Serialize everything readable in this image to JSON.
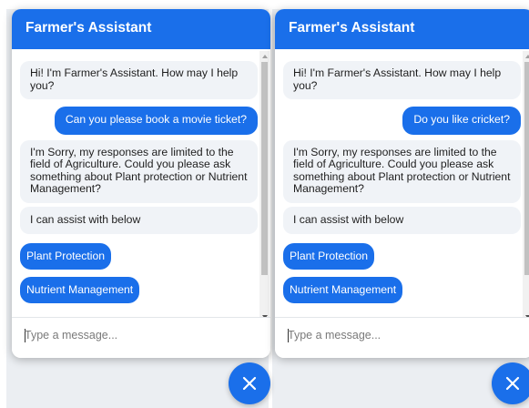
{
  "colors": {
    "accent": "#1a6fea",
    "bot_bubble": "#f0f3f7",
    "background": "#ebeef2"
  },
  "left_chat": {
    "title": "Farmer's Assistant",
    "greeting": "Hi! I'm Farmer's Assistant. How may I help you?",
    "user_message": "Can you please book a movie ticket?",
    "bot_reply": "I'm Sorry, my responses are limited to the field of Agriculture. Could you please ask something about Plant protection or Nutrient Management?",
    "assist_text": "I can assist with below",
    "options": [
      "Plant Protection",
      "Nutrient Management"
    ],
    "input_placeholder": "Type a message..."
  },
  "right_chat": {
    "title": "Farmer's Assistant",
    "greeting": "Hi! I'm Farmer's Assistant. How may I help you?",
    "user_message": "Do you like cricket?",
    "bot_reply": "I'm Sorry, my responses are limited to the field of Agriculture. Could you please ask something about Plant protection or Nutrient Management?",
    "assist_text": "I can assist with below",
    "options": [
      "Plant Protection",
      "Nutrient Management"
    ],
    "input_placeholder": "Type a message..."
  },
  "close_button_icon": "close-icon"
}
